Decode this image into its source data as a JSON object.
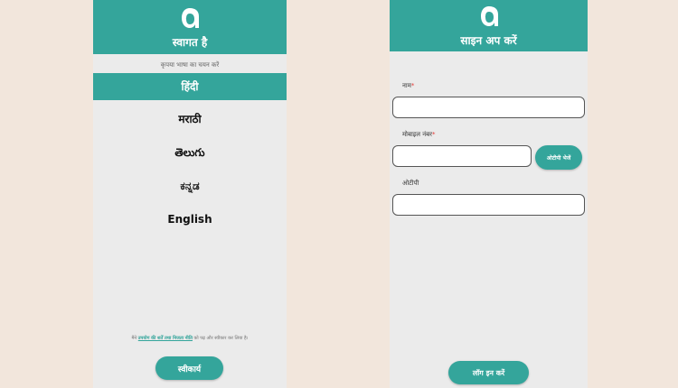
{
  "language_screen": {
    "header_title": "स्वागत है",
    "subtitle": "कृपया भाषा का चयन करें",
    "languages": [
      {
        "label": "हिंदी",
        "selected": true
      },
      {
        "label": "मराठी",
        "selected": false
      },
      {
        "label": "తెలుగు",
        "selected": false
      },
      {
        "label": "ಕನ್ನಡ",
        "selected": false
      },
      {
        "label": "English",
        "selected": false
      }
    ],
    "terms": {
      "prefix": "मैंने ",
      "link_text": "उपयोग की शर्तें तथा निजता नीति",
      "suffix": " को पढ़ और स्वीकार कर लिया है।"
    },
    "accept_label": "स्वीकार्य"
  },
  "signup_screen": {
    "header_title": "साइन अप करें",
    "name_label": "नाम",
    "mobile_label": "मोबाइल नंबर",
    "otp_label": "ओटीपी",
    "required_marker": "*",
    "send_otp_label": "ओटीपी भेजें",
    "login_label": "लॉग इन करें",
    "name_value": "",
    "mobile_value": "",
    "otp_value": ""
  },
  "colors": {
    "accent": "#34a59b",
    "background": "#f2e6dc",
    "screen": "#ebebeb",
    "required": "#e53935"
  },
  "icons": {
    "logo": "app-logo-icon"
  }
}
